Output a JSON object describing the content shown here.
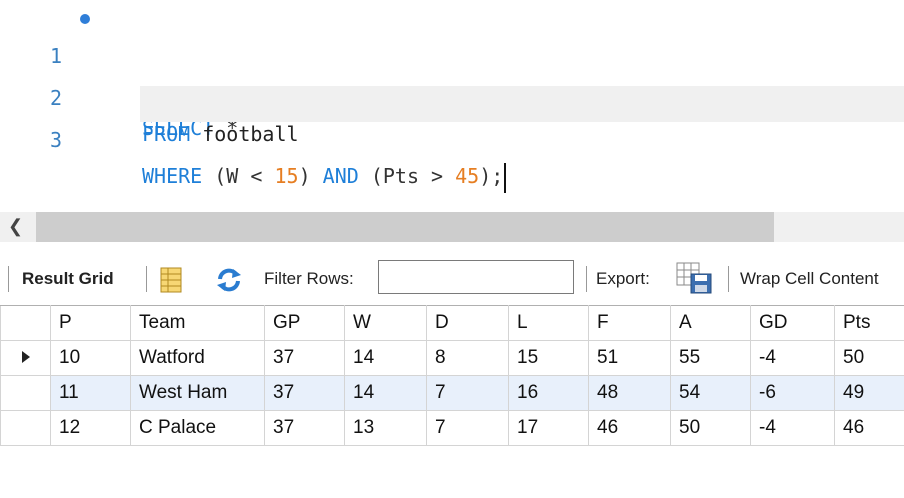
{
  "editor": {
    "lines": [
      {
        "number": "1",
        "tokens": [
          "SELECT",
          " *"
        ]
      },
      {
        "number": "2",
        "tokens": [
          "FROM",
          " football"
        ]
      },
      {
        "number": "3",
        "tokens": [
          "WHERE",
          " (W < ",
          "15",
          ") ",
          "AND",
          " (Pts > ",
          "45",
          ");"
        ]
      }
    ]
  },
  "toolbar": {
    "result_grid_label": "Result Grid",
    "filter_rows_label": "Filter Rows:",
    "filter_value": "",
    "export_label": "Export:",
    "wrap_label": "Wrap Cell Content"
  },
  "grid": {
    "columns": [
      "P",
      "Team",
      "GP",
      "W",
      "D",
      "L",
      "F",
      "A",
      "GD",
      "Pts"
    ],
    "rows": [
      [
        "10",
        "Watford",
        "37",
        "14",
        "8",
        "15",
        "51",
        "55",
        "-4",
        "50"
      ],
      [
        "11",
        "West Ham",
        "37",
        "14",
        "7",
        "16",
        "48",
        "54",
        "-6",
        "49"
      ],
      [
        "12",
        "C Palace",
        "37",
        "13",
        "7",
        "17",
        "46",
        "50",
        "-4",
        "46"
      ]
    ]
  },
  "colors": {
    "keyword": "#1e7fd8",
    "number": "#e67e22",
    "line_number": "#3a80c0",
    "alt_row": "#e8f0fb"
  }
}
